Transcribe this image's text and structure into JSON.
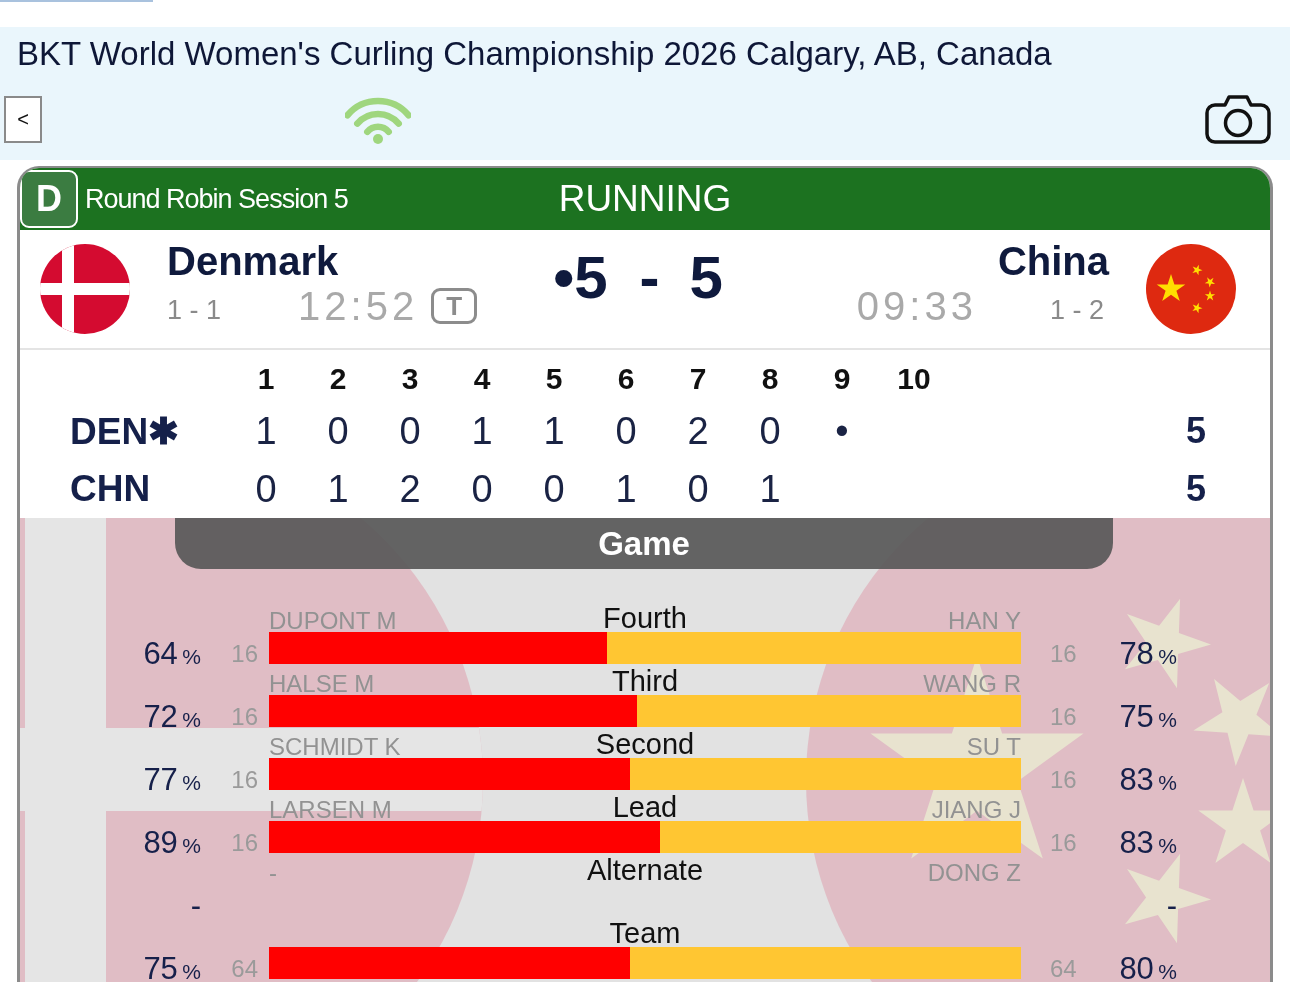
{
  "header": {
    "title": "BKT World Women's Curling Championship 2026 Calgary, AB, Canada",
    "back_button": "<"
  },
  "scoreboard": {
    "sheet": "D",
    "session": "Round Robin Session 5",
    "status": "RUNNING",
    "teams": [
      {
        "name": "Denmark",
        "kind": "denmark",
        "record": "1 - 1",
        "clock": "12:52",
        "timeout": "T"
      },
      {
        "name": "China",
        "kind": "china",
        "record": "1 - 2",
        "clock": "09:33"
      }
    ],
    "score": {
      "home": "•5",
      "separator": "-",
      "away": "5"
    }
  },
  "linescore": {
    "ends": [
      "1",
      "2",
      "3",
      "4",
      "5",
      "6",
      "7",
      "8",
      "9",
      "10"
    ],
    "rows": [
      {
        "team": "DEN✱",
        "ends": [
          "1",
          "0",
          "0",
          "1",
          "1",
          "0",
          "2",
          "0",
          "•"
        ],
        "total": "5"
      },
      {
        "team": "CHN",
        "ends": [
          "0",
          "1",
          "2",
          "0",
          "0",
          "1",
          "0",
          "1"
        ],
        "total": "5"
      }
    ]
  },
  "stats": {
    "title": "Game",
    "rows": [
      {
        "position": "Fourth",
        "level": 0.45,
        "home": {
          "player": "DUPONT M",
          "shots": "16",
          "pct": "64",
          "unit": "%"
        },
        "away": {
          "player": "HAN Y",
          "shots": "16",
          "pct": "78",
          "unit": "%"
        }
      },
      {
        "position": "Third",
        "level": 0.49,
        "home": {
          "player": "HALSE M",
          "shots": "16",
          "pct": "72",
          "unit": "%"
        },
        "away": {
          "player": "WANG R",
          "shots": "16",
          "pct": "75",
          "unit": "%"
        }
      },
      {
        "position": "Second",
        "level": 0.48,
        "home": {
          "player": "SCHMIDT K",
          "shots": "16",
          "pct": "77",
          "unit": "%"
        },
        "away": {
          "player": "SU T",
          "shots": "16",
          "pct": "83",
          "unit": "%"
        }
      },
      {
        "position": "Lead",
        "level": 0.52,
        "home": {
          "player": "LARSEN M",
          "shots": "16",
          "pct": "89",
          "unit": "%"
        },
        "away": {
          "player": "JIANG J",
          "shots": "16",
          "pct": "83",
          "unit": "%"
        }
      },
      {
        "position": "Alternate",
        "home": {
          "player": "-",
          "pct": "-"
        },
        "away": {
          "player": "DONG Z",
          "pct": "-"
        }
      },
      {
        "position": "Team",
        "level": 0.48,
        "home": {
          "shots": "64",
          "pct": "75",
          "unit": "%"
        },
        "away": {
          "shots": "64",
          "pct": "80",
          "unit": "%"
        }
      }
    ]
  }
}
